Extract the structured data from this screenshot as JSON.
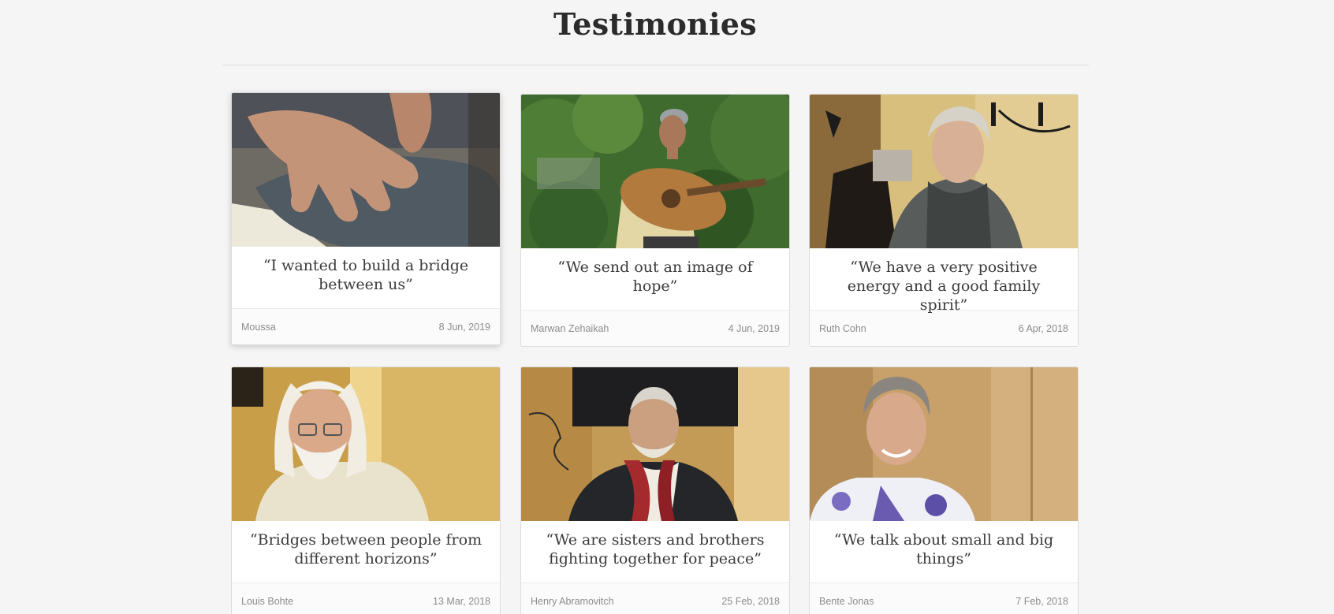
{
  "page": {
    "title": "Testimonies"
  },
  "cards": [
    {
      "quote": "“I wanted to build a bridge between us”",
      "author": "Moussa",
      "date": "8 Jun, 2019",
      "photo": "hands-on-knee-photo"
    },
    {
      "quote": "“We send out an image of hope”",
      "author": "Marwan Zehaikah",
      "date": "4 Jun, 2019",
      "photo": "man-with-oud-photo"
    },
    {
      "quote": "“We have a very positive energy and a good family spirit”",
      "author": "Ruth Cohn",
      "date": "6 Apr, 2018",
      "photo": "woman-with-scarf-photo"
    },
    {
      "quote": "“Bridges between people from different horizons”",
      "author": "Louis Bohte",
      "date": "13 Mar, 2018",
      "photo": "bearded-man-photo"
    },
    {
      "quote": "“We are sisters and brothers fighting together for peace”",
      "author": "Henry Abramovitch",
      "date": "25 Feb, 2018",
      "photo": "man-with-red-scarf-photo"
    },
    {
      "quote": "“We talk about small and big things”",
      "author": "Bente Jonas",
      "date": "7 Feb, 2018",
      "photo": "smiling-woman-photo"
    }
  ],
  "colors": {
    "background": "#f5f5f5",
    "card": "#ffffff",
    "title": "#2b2b2b",
    "quote": "#3a3a3a",
    "meta": "#8c8c8c"
  }
}
